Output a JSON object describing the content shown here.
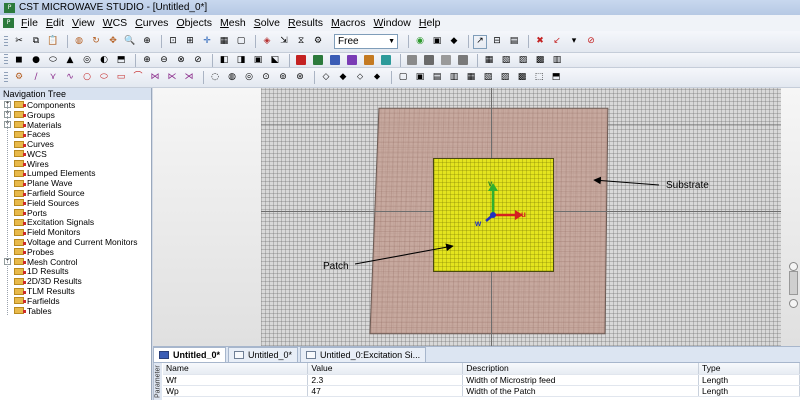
{
  "window": {
    "title": "CST MICROWAVE STUDIO - [Untitled_0*]",
    "icon": "cst-app-icon"
  },
  "menu": [
    "File",
    "Edit",
    "View",
    "WCS",
    "Curves",
    "Objects",
    "Mesh",
    "Solve",
    "Results",
    "Macros",
    "Window",
    "Help"
  ],
  "toolbar": {
    "mesh_mode_value": "Free"
  },
  "nav_tree": {
    "title": "Navigation Tree",
    "items": [
      {
        "label": "Components",
        "expandable": true
      },
      {
        "label": "Groups",
        "expandable": true
      },
      {
        "label": "Materials",
        "expandable": true
      },
      {
        "label": "Faces",
        "expandable": false
      },
      {
        "label": "Curves",
        "expandable": false
      },
      {
        "label": "WCS",
        "expandable": false
      },
      {
        "label": "Wires",
        "expandable": false
      },
      {
        "label": "Lumped Elements",
        "expandable": false
      },
      {
        "label": "Plane Wave",
        "expandable": false
      },
      {
        "label": "Farfield Source",
        "expandable": false
      },
      {
        "label": "Field Sources",
        "expandable": false
      },
      {
        "label": "Ports",
        "expandable": false
      },
      {
        "label": "Excitation Signals",
        "expandable": false
      },
      {
        "label": "Field Monitors",
        "expandable": false
      },
      {
        "label": "Voltage and Current Monitors",
        "expandable": false
      },
      {
        "label": "Probes",
        "expandable": false
      },
      {
        "label": "Mesh Control",
        "expandable": true
      },
      {
        "label": "1D Results",
        "expandable": false
      },
      {
        "label": "2D/3D Results",
        "expandable": false
      },
      {
        "label": "TLM Results",
        "expandable": false
      },
      {
        "label": "Farfields",
        "expandable": false
      },
      {
        "label": "Tables",
        "expandable": false
      }
    ]
  },
  "viewport": {
    "substrate_label": "Substrate",
    "patch_label": "Patch",
    "axis_v": "v",
    "axis_u": "u",
    "axis_w": "w",
    "colors": {
      "substrate": "#c4a296",
      "patch": "#e4e41e",
      "u_axis": "#d42020",
      "v_axis": "#30b030",
      "w_axis": "#2030c0"
    }
  },
  "tabs": [
    {
      "label": "Untitled_0*",
      "active": true
    },
    {
      "label": "Untitled_0*",
      "active": false
    },
    {
      "label": "Untitled_0:Excitation Si...",
      "active": false
    }
  ],
  "params": {
    "side_label": "Parameter",
    "headers": [
      "Name",
      "Value",
      "Description",
      "Type"
    ],
    "rows": [
      [
        "Wf",
        "2.3",
        "Width of Microstrip feed",
        "Length"
      ],
      [
        "Wp",
        "47",
        "Width of the Patch",
        "Length"
      ]
    ]
  }
}
